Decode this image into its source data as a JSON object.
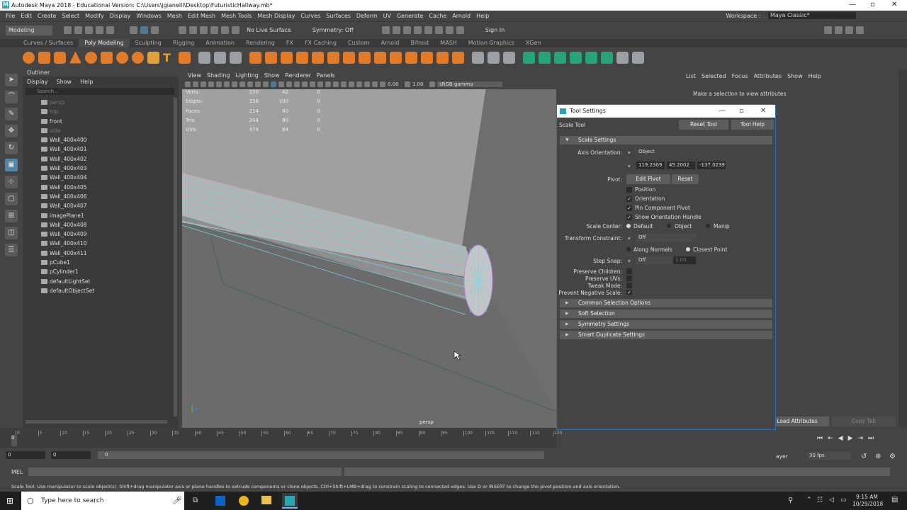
{
  "window": {
    "title": "Autodesk Maya 2018 - Educational Version: C:\\Users\\jgianelli\\Desktop\\FuturisticHallway.mb*"
  },
  "menus": [
    "File",
    "Edit",
    "Create",
    "Select",
    "Modify",
    "Display",
    "Windows",
    "Mesh",
    "Edit Mesh",
    "Mesh Tools",
    "Mesh Display",
    "Curves",
    "Surfaces",
    "Deform",
    "UV",
    "Generate",
    "Cache",
    "Arnold",
    "Help"
  ],
  "workspace": {
    "label": "Workspace :",
    "value": "Maya Classic*"
  },
  "statusline": {
    "mode": "Modeling",
    "live": "No Live Surface",
    "symmetry": "Symmetry: Off",
    "signin": "Sign In"
  },
  "shelf_tabs": [
    "Curves / Surfaces",
    "Poly Modeling",
    "Sculpting",
    "Rigging",
    "Animation",
    "Rendering",
    "FX",
    "FX Caching",
    "Custom",
    "Arnold",
    "Bifrost",
    "MASH",
    "Motion Graphics",
    "XGen"
  ],
  "shelf_active": "Poly Modeling",
  "outliner": {
    "title": "Outliner",
    "menu": [
      "Display",
      "Show",
      "Help"
    ],
    "search_placeholder": "Search...",
    "items": [
      {
        "label": "persp",
        "dim": true
      },
      {
        "label": "top",
        "dim": true
      },
      {
        "label": "front",
        "dim": false
      },
      {
        "label": "side",
        "dim": true
      },
      {
        "label": "Wall_400x400",
        "dim": false
      },
      {
        "label": "Wall_400x401",
        "dim": false
      },
      {
        "label": "Wall_400x402",
        "dim": false
      },
      {
        "label": "Wall_400x403",
        "dim": false
      },
      {
        "label": "Wall_400x404",
        "dim": false
      },
      {
        "label": "Wall_400x405",
        "dim": false
      },
      {
        "label": "Wall_400x406",
        "dim": false
      },
      {
        "label": "Wall_400x407",
        "dim": false
      },
      {
        "label": "imagePlane1",
        "dim": false
      },
      {
        "label": "Wall_400x408",
        "dim": false
      },
      {
        "label": "Wall_400x409",
        "dim": false
      },
      {
        "label": "Wall_400x410",
        "dim": false
      },
      {
        "label": "Wall_400x411",
        "dim": false
      },
      {
        "label": "pCube1",
        "dim": false
      },
      {
        "label": "pCylinder1",
        "dim": false
      },
      {
        "label": "defaultLightSet",
        "dim": false
      },
      {
        "label": "defaultObjectSet",
        "dim": false
      }
    ]
  },
  "viewport": {
    "menu": [
      "View",
      "Shading",
      "Lighting",
      "Show",
      "Renderer",
      "Panels"
    ],
    "exposure": "0.00",
    "gamma": "1.00",
    "colorspace": "sRGB gamma",
    "hud": [
      {
        "k": "Verts:",
        "a": "150",
        "b": "42",
        "c": "0"
      },
      {
        "k": "Edges:",
        "a": "336",
        "b": "100",
        "c": "0"
      },
      {
        "k": "Faces:",
        "a": "214",
        "b": "60",
        "c": "0"
      },
      {
        "k": "Tris:",
        "a": "244",
        "b": "80",
        "c": "0"
      },
      {
        "k": "UVs:",
        "a": "474",
        "b": "84",
        "c": "0"
      }
    ],
    "camera": "persp"
  },
  "attribute_editor": {
    "menu": [
      "List",
      "Selected",
      "Focus",
      "Attributes",
      "Show",
      "Help"
    ],
    "message": "Make a selection to view attributes",
    "load": "Load Attributes",
    "copy": "Copy Tab"
  },
  "tool_settings": {
    "title": "Tool Settings",
    "tool": "Scale Tool",
    "reset": "Reset Tool",
    "help": "Tool Help",
    "section": "Scale Settings",
    "axis_label": "Axis Orientation:",
    "axis_value": "Object",
    "xyz": [
      "119.2309",
      "45.2002",
      "-137.0239"
    ],
    "pivot_label": "Pivot:",
    "edit_pivot": "Edit Pivot",
    "pivot_reset": "Reset",
    "checks": [
      {
        "label": "Position",
        "checked": false
      },
      {
        "label": "Orientation",
        "checked": true
      },
      {
        "label": "Pin Component Pivot",
        "checked": true
      },
      {
        "label": "Show Orientation Handle",
        "checked": true
      }
    ],
    "scale_center_label": "Scale Center:",
    "scale_center": [
      "Default",
      "Object",
      "Manip"
    ],
    "transform_label": "Transform Constraint:",
    "transform_value": "Off",
    "along_normals": "Along Normals",
    "closest_point": "Closest Point",
    "step_label": "Step Snap:",
    "step_value": "Off",
    "step_num": "1.00",
    "preserve_children": "Preserve Children:",
    "preserve_uvs": "Preserve UVs:",
    "tweak": "Tweak Mode:",
    "prevent": "Prevent Negative Scale:",
    "sections": [
      "Common Selection Options",
      "Soft Selection",
      "Symmetry Settings",
      "Smart Duplicate Settings"
    ]
  },
  "timeline": {
    "ticks": [
      "0",
      "5",
      "10",
      "15",
      "20",
      "25",
      "30",
      "35",
      "40",
      "45",
      "50",
      "55",
      "60",
      "65",
      "70",
      "75",
      "80",
      "85",
      "90",
      "95",
      "100",
      "105",
      "110",
      "115",
      "120"
    ],
    "start": "0",
    "current": "0",
    "range_start": "0"
  },
  "playback": {
    "fps": "30 fps",
    "layer": "ayer"
  },
  "cmd": {
    "label": "MEL"
  },
  "helpline": "Scale Tool: Use manipulator to scale object(s). Shift+drag manipulator axis or plane handles to extrude components or clone objects. Ctrl+Shift+LMB+drag to constrain scaling to connected edges. Use D or INSERT to change the pivot position and axis orientation.",
  "taskbar": {
    "search": "Type here to search",
    "time": "9:15 AM",
    "date": "10/29/2018"
  }
}
